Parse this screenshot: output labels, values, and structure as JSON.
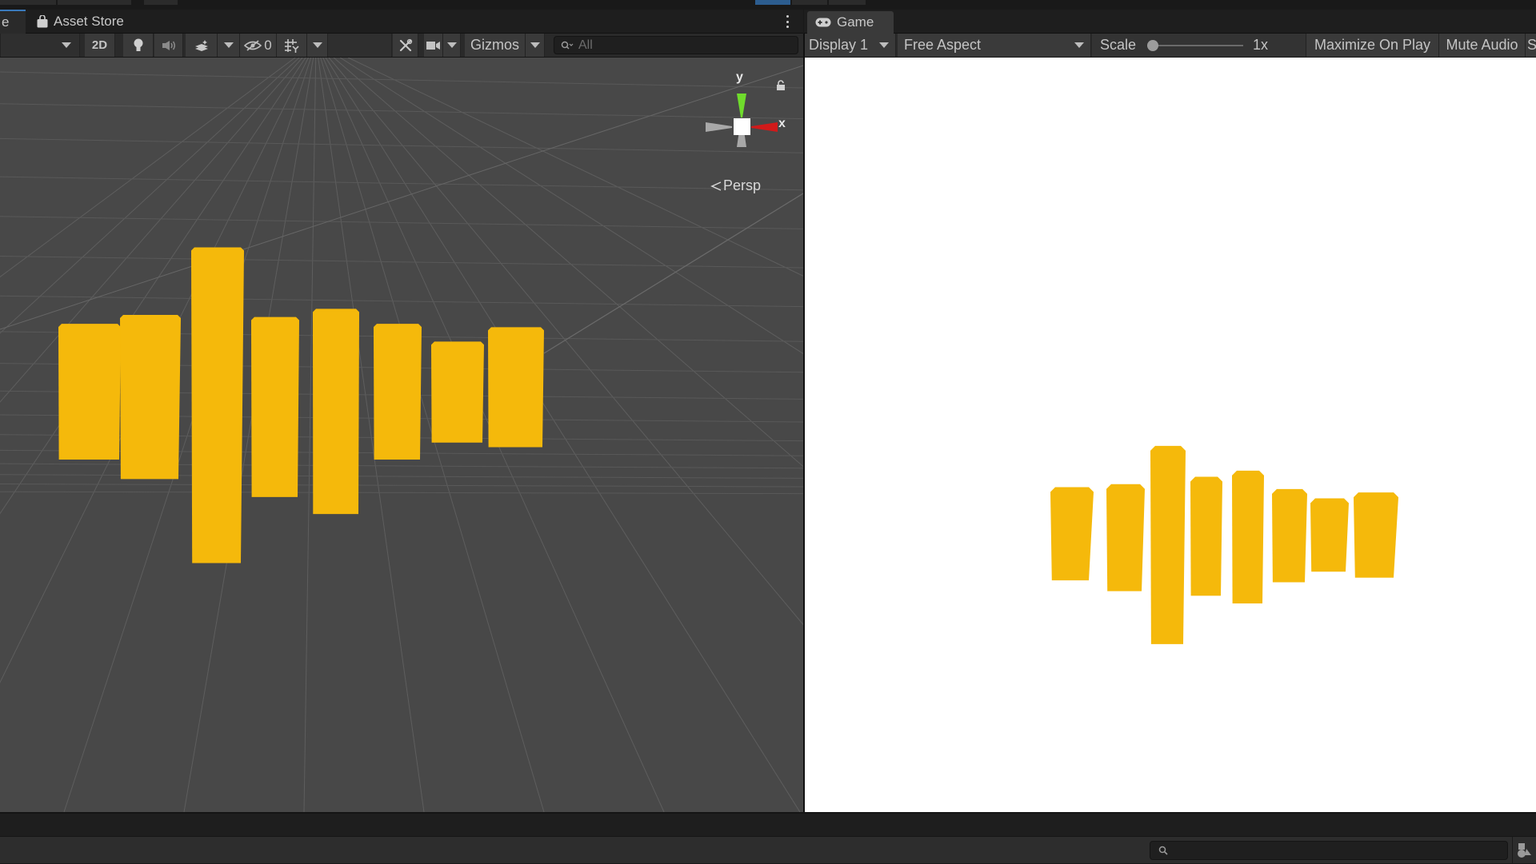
{
  "tabs": {
    "scene_tab_partial": "e",
    "asset_store": "Asset Store",
    "game": "Game"
  },
  "scene_toolbar": {
    "mode_2d": "2D",
    "hidden_count": "0",
    "gizmos": "Gizmos",
    "search_placeholder": "All",
    "icons": [
      "draw-mode-dropdown",
      "lighting-toggle",
      "audio-toggle",
      "effects-toggle",
      "effects-dropdown",
      "hidden-objects-toggle",
      "grid-toggle",
      "grid-dropdown",
      "tools-icon",
      "camera-icon",
      "camera-dropdown",
      "gizmos-dropdown"
    ]
  },
  "game_toolbar": {
    "display": "Display 1",
    "aspect": "Free Aspect",
    "scale_label": "Scale",
    "scale_value": "1x",
    "scale_fraction": 0.0,
    "maximize_on_play": "Maximize On Play",
    "mute_audio": "Mute Audio",
    "stats_partial": "S"
  },
  "scene_gizmo": {
    "y_label": "y",
    "x_label": "x",
    "projection": "Persp",
    "colors": {
      "y": "#6fdc2c",
      "x": "#d11a1a",
      "neutral": "#a8a8a8",
      "center": "#ffffff"
    }
  },
  "scene_objects": {
    "color": "#f5b90b",
    "bar_count": 8,
    "relative_heights": [
      0.43,
      0.52,
      1.0,
      0.57,
      0.65,
      0.43,
      0.32,
      0.38
    ]
  },
  "game_objects": {
    "color": "#f5b90b",
    "bar_count": 8,
    "relative_heights": [
      0.47,
      0.54,
      1.0,
      0.6,
      0.67,
      0.47,
      0.37,
      0.43
    ]
  },
  "bottom_bar": {
    "search_placeholder": ""
  },
  "colors": {
    "scene_bg": "#484848",
    "game_bg": "#ffffff",
    "accent_tab": "#3a79bb"
  }
}
